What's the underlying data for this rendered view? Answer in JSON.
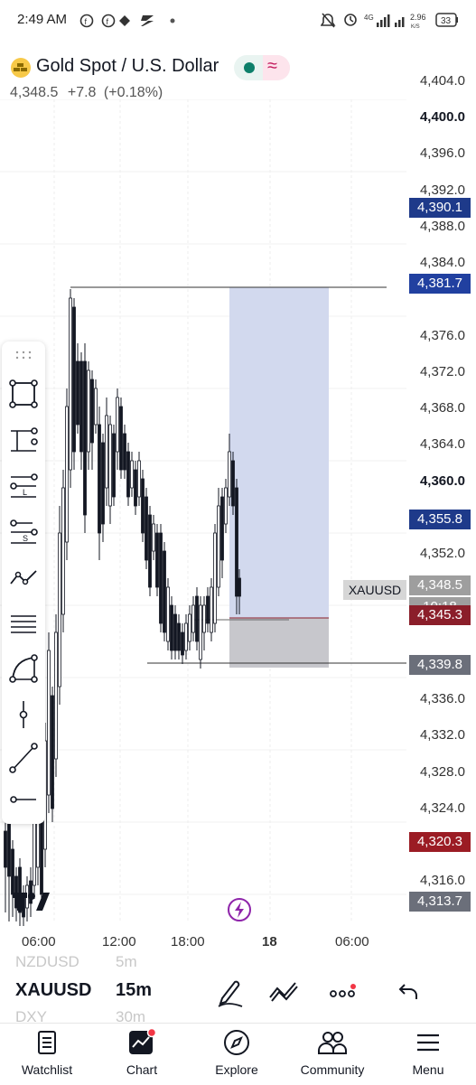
{
  "status_bar": {
    "time": "2:49 AM",
    "network": "4G",
    "speed_value": "2.96",
    "speed_unit": "K/S",
    "battery": "33"
  },
  "header": {
    "symbol_title": "Gold Spot / U.S. Dollar",
    "last_price": "4,348.5",
    "change": "+7.8",
    "change_pct": "(+0.18%)"
  },
  "price_axis": {
    "ticks": [
      "4,404.0",
      "4,400.0",
      "4,396.0",
      "4,392.0",
      "4,388.0",
      "4,384.0",
      "4,376.0",
      "4,372.0",
      "4,368.0",
      "4,364.0",
      "4,360.0",
      "4,352.0",
      "4,336.0",
      "4,332.0",
      "4,328.0",
      "4,324.0",
      "4,316.0"
    ],
    "bold_ticks": [
      "4,400.0",
      "4,360.0"
    ],
    "labels": [
      {
        "text": "4,390.1",
        "color": "#1e3a8a"
      },
      {
        "text": "4,381.7",
        "color": "#2140a0"
      },
      {
        "text": "4,355.8",
        "color": "#1e3a8a"
      },
      {
        "text": "4,348.5",
        "color": "#9e9e9e"
      },
      {
        "text": "10:18",
        "color": "#9e9e9e"
      },
      {
        "text": "4,345.3",
        "color": "#8b1e2a"
      },
      {
        "text": "4,339.8",
        "color": "#6b6f7a"
      },
      {
        "text": "4,320.3",
        "color": "#9b1c24"
      },
      {
        "text": "4,313.7",
        "color": "#6b6f7a"
      }
    ],
    "symbol_tag": "XAUUSD"
  },
  "time_axis": {
    "ticks": [
      "06:00",
      "12:00",
      "18:00",
      "18",
      "06:00"
    ]
  },
  "toolbar": {
    "tools": [
      "rectangle-tool-icon",
      "long-position-icon",
      "anchored-text-icon",
      "price-note-icon",
      "trend-angle-icon",
      "horizontal-lines-icon",
      "curve-tool-icon",
      "vertical-line-icon",
      "trend-line-icon",
      "horizontal-ray-icon"
    ],
    "anchored_letter": "L",
    "price_letter": "S"
  },
  "symbol_switcher": {
    "prev_symbol": "NZDUSD",
    "prev_interval": "5m",
    "symbol": "XAUUSD",
    "interval": "15m",
    "next_symbol": "DXY",
    "next_interval": "30m"
  },
  "bottom_nav": {
    "items": [
      {
        "label": "Watchlist",
        "icon": "watchlist-icon"
      },
      {
        "label": "Chart",
        "icon": "chart-icon"
      },
      {
        "label": "Explore",
        "icon": "compass-icon"
      },
      {
        "label": "Community",
        "icon": "community-icon"
      },
      {
        "label": "Menu",
        "icon": "menu-icon"
      }
    ]
  },
  "colors": {
    "accent_purple": "#8e24aa",
    "up": "#131722",
    "down": "#131722",
    "notification": "#f23645"
  }
}
